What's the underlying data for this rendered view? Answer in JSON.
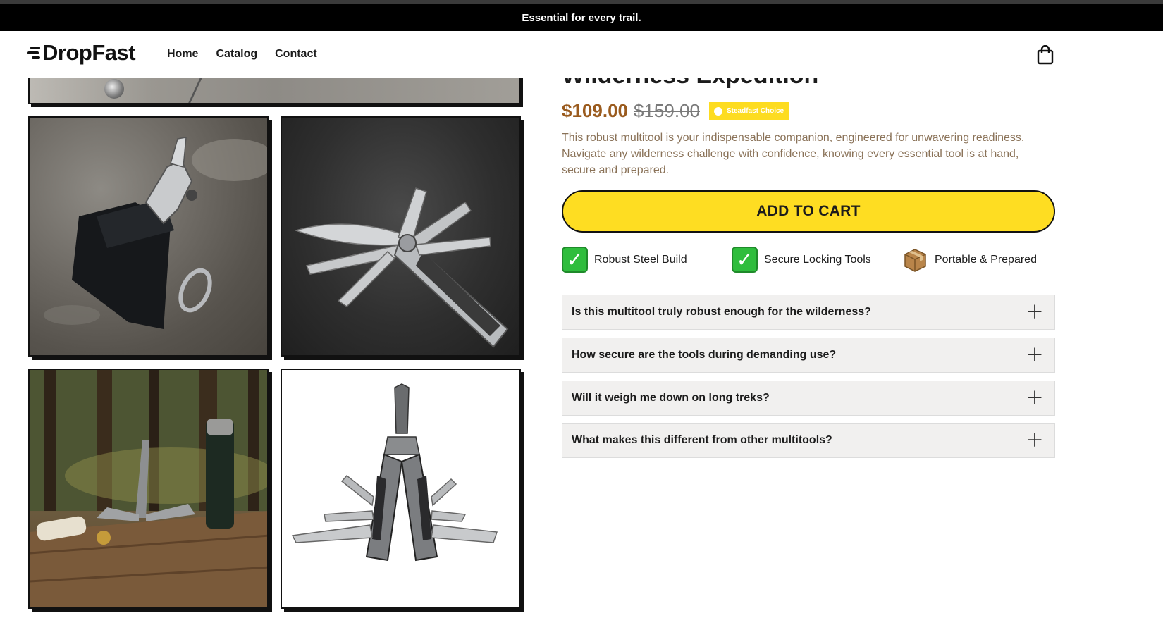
{
  "announcement": {
    "text": "Essential for every trail."
  },
  "header": {
    "logo": "DropFast",
    "nav": [
      {
        "label": "Home"
      },
      {
        "label": "Catalog"
      },
      {
        "label": "Contact"
      }
    ],
    "cart_icon": "shopping-bag-icon"
  },
  "product": {
    "title": "Wilderness Expedition",
    "price": "$109.00",
    "compare_price": "$159.00",
    "badge": "Steadfast Choice",
    "description": "This robust multitool is your indispensable companion, engineered for unwavering readiness. Navigate any wilderness challenge with confidence, knowing every essential tool is at hand, secure and prepared.",
    "cta": "ADD TO CART",
    "features": [
      {
        "icon": "check-mark-icon",
        "label": "Robust Steel Build"
      },
      {
        "icon": "check-mark-icon",
        "label": "Secure Locking Tools"
      },
      {
        "icon": "package-icon",
        "label": "Portable & Prepared"
      }
    ],
    "faq": [
      {
        "question": "Is this multitool truly robust enough for the wilderness?"
      },
      {
        "question": "How secure are the tools during demanding use?"
      },
      {
        "question": "Will it weigh me down on long treks?"
      },
      {
        "question": "What makes this different from other multitools?"
      }
    ]
  },
  "colors": {
    "accent_yellow": "#fedd22",
    "price_brown": "#9a5b1e",
    "faq_bg": "#f1f0ef",
    "announcement_bg": "#000000"
  }
}
